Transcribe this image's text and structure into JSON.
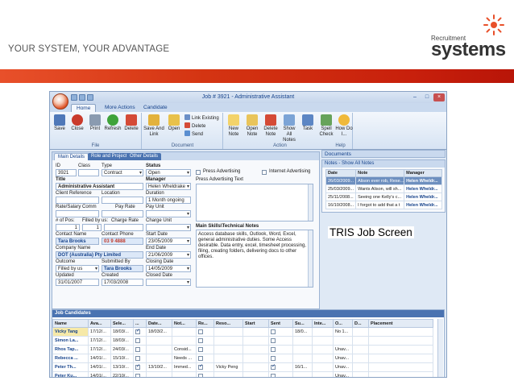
{
  "slide": {
    "tagline": "YOUR SYSTEM, YOUR ADVANTAGE",
    "logo_small": "Recruitment",
    "logo_big": "systems",
    "caption": "TRIS Job Screen"
  },
  "app": {
    "title": "Job # 3921 - Administrative Assistant",
    "tabs": [
      "Home",
      "More Actions",
      "Candidate"
    ],
    "ribbon": {
      "file_group": "File",
      "file_buttons": [
        "Save",
        "Close",
        "Print",
        "Refresh",
        "Delete"
      ],
      "doc_group": "Document",
      "doc_buttons": [
        "Save And Link",
        "Open"
      ],
      "doc_small": [
        "Link Existing",
        "Delete",
        "Send"
      ],
      "action_group": "Action",
      "action_buttons": [
        "New Note",
        "Open Note",
        "Delete Note",
        "Show All Notes",
        "Task",
        "Spell Check",
        "How Do I..."
      ],
      "help_group": "Help"
    },
    "details": {
      "tabs": [
        "Main Details",
        "Role and Project",
        "Other Details"
      ],
      "labels": {
        "id": "ID",
        "class": "Class",
        "type": "Type",
        "status": "Status",
        "title": "Title",
        "manager": "Manager",
        "client_ref": "Client Reference",
        "location": "Location",
        "duration": "Duration",
        "rate_salary": "Rate/Salary Comm",
        "pay_rate": "Pay Rate",
        "pay_unit": "Pay Unit",
        "num_pos": "# of Pos:",
        "filled_by": "Filled by us:",
        "charge_rate": "Charge Rate",
        "charge_unit": "Charge Unit",
        "contact_name": "Contact Name",
        "contact_phone": "Contact Phone",
        "start_date": "Start Date",
        "company_name": "Company Name",
        "end_date": "End Date",
        "outcome": "Outcome",
        "submitted_by": "Submitted By",
        "closing_date": "Closing Date",
        "updated": "Updated",
        "created": "Created",
        "closed_date": "Closed Date",
        "press_advertising": "Press Advertising",
        "internet_advertising": "Internet Advertising",
        "press_text": "Press Advertising Text",
        "main_skills": "Main Skills\\Technical Notes"
      },
      "values": {
        "id": "3921",
        "type": "Contract",
        "status": "Open",
        "title": "Administrative Assistant",
        "manager": "Helen Wheldrake",
        "duration": "1 Month ongoing",
        "num_pos": "1",
        "filled_by": "1",
        "contact_name": "Tara Brooks",
        "contact_phone": "03 9 4888",
        "start_date": "23/05/2009",
        "company_name": "DOT (Australia) Pty Limited",
        "end_date": "21/06/2009",
        "outcome": "Filled by us",
        "submitted_by": "Tara Brooks",
        "closing_date": "14/05/2009",
        "updated": "31/01/2007",
        "created": "17/03/2008",
        "main_skills_text": "Access database skills, Outlook, Word, Excel, general administrative duties. Some Access desirable. Data entry, excel, timesheet processing, filing, creating folders, delivering docs to other offices."
      }
    },
    "documents": {
      "title": "Documents"
    },
    "notes": {
      "title": "Notes - Show All Notes",
      "columns": [
        "Date",
        "Note",
        "Manager"
      ],
      "rows": [
        [
          "26/03/2009...",
          "Alison ever rob, Rese...",
          "Helen Wheldr..."
        ],
        [
          "25/03/2009...",
          "Wants Alison, will sh...",
          "Helen Wheldr..."
        ],
        [
          "25/11/2008...",
          "Seeing one Kelly's c...",
          "Helen Wheldr..."
        ],
        [
          "16/10/2008...",
          "I forgot to add that a t",
          "Helen Wheldr..."
        ]
      ]
    },
    "candidates": {
      "title": "Job Candidates",
      "columns": [
        "Name",
        "Ava...",
        "Sele...",
        "...",
        "Date...",
        "Not...",
        "Re...",
        "Reso...",
        "Start",
        "Sent",
        "Su...",
        "Inte...",
        "O...",
        "D...",
        "Placement"
      ],
      "rows": [
        [
          "Vicky Tang",
          "17/12/...",
          "18/03/...",
          "on",
          "18/03/2...",
          "",
          "",
          "",
          "",
          "",
          "18/0...",
          "",
          "No 1...",
          "",
          ""
        ],
        [
          "Simon La...",
          "17/12/...",
          "18/03/...",
          "",
          "",
          "",
          "",
          "",
          "",
          "",
          "",
          "",
          "",
          "",
          ""
        ],
        [
          "Rhos Tap...",
          "17/12/...",
          "24/03/...",
          "",
          "",
          "Consid...",
          "",
          "",
          "",
          "",
          "",
          "",
          "Unav...",
          "",
          ""
        ],
        [
          "Rebecca ...",
          "14/01/...",
          "15/10/...",
          "",
          "",
          "Needs ...",
          "",
          "",
          "",
          "",
          "",
          "",
          "Unav...",
          "",
          ""
        ],
        [
          "Peter Th...",
          "14/01/...",
          "13/10/...",
          "on",
          "13/10/2...",
          "Immed...",
          "on",
          "Vicky Peng",
          "",
          "on",
          "16/1...",
          "",
          "Unav...",
          "",
          ""
        ],
        [
          "Peter Ku...",
          "14/01/...",
          "22/10/...",
          "",
          "",
          "",
          "",
          "",
          "",
          "",
          "",
          "",
          "Unav...",
          "",
          ""
        ]
      ]
    }
  },
  "colors": {
    "brand_orange": "#d43412",
    "ribbon_blue": "#15428b",
    "panel_header": "#4a73b1"
  }
}
